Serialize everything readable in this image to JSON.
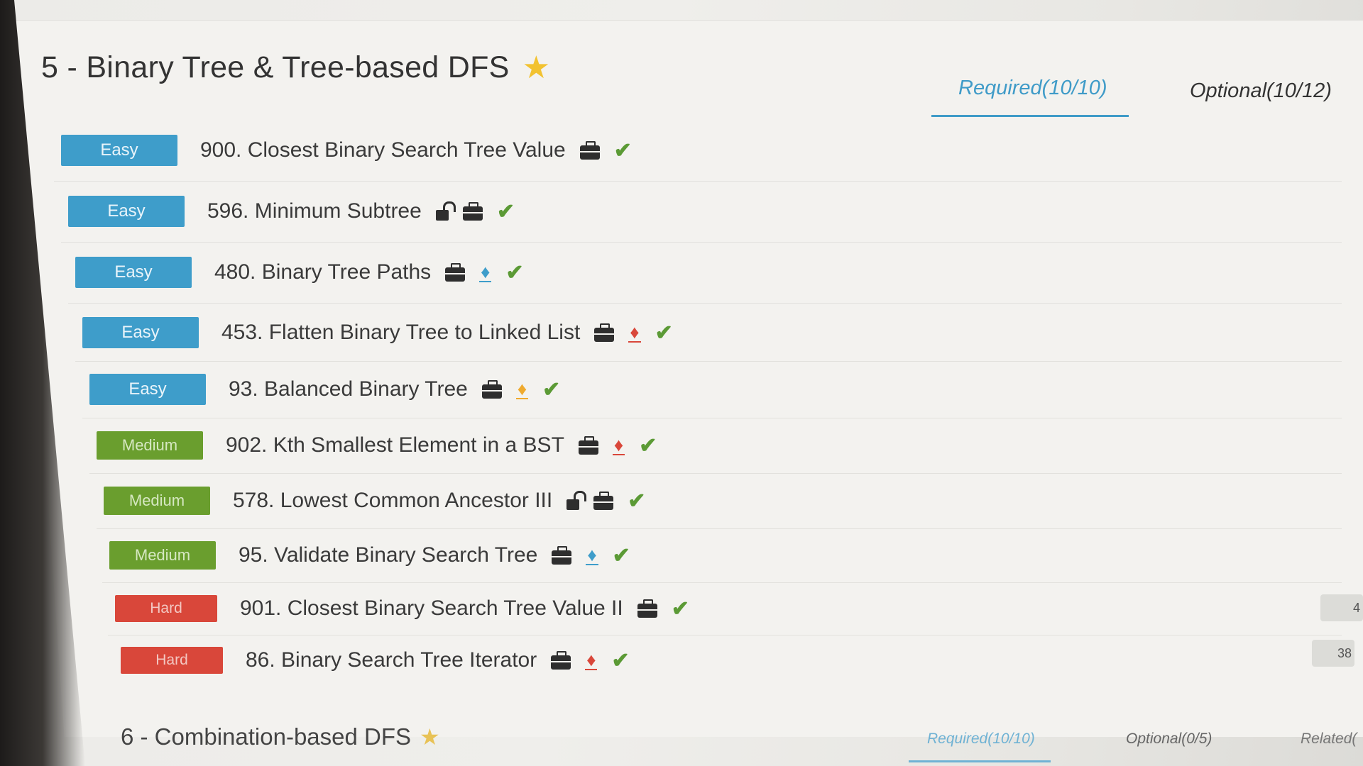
{
  "section": {
    "title": "5 - Binary Tree & Tree-based DFS",
    "star_icon": "star-icon",
    "tabs": {
      "required": "Required(10/10)",
      "optional": "Optional(10/12)"
    }
  },
  "problems": [
    {
      "difficulty": "Easy",
      "title": "900. Closest Binary Search Tree Value",
      "icons": [
        "briefcase-icon",
        "check-icon"
      ]
    },
    {
      "difficulty": "Easy",
      "title": "596. Minimum Subtree",
      "icons": [
        "unlock-icon",
        "briefcase-icon",
        "check-icon"
      ]
    },
    {
      "difficulty": "Easy",
      "title": "480. Binary Tree Paths",
      "icons": [
        "briefcase-icon",
        "flame-blue-icon",
        "check-icon"
      ]
    },
    {
      "difficulty": "Easy",
      "title": "453. Flatten Binary Tree to Linked List",
      "icons": [
        "briefcase-icon",
        "flame-red-icon",
        "check-icon"
      ]
    },
    {
      "difficulty": "Easy",
      "title": "93. Balanced Binary Tree",
      "icons": [
        "briefcase-icon",
        "flame-orange-icon",
        "check-icon"
      ]
    },
    {
      "difficulty": "Medium",
      "title": "902. Kth Smallest Element in a BST",
      "icons": [
        "briefcase-icon",
        "flame-red-icon",
        "check-icon"
      ]
    },
    {
      "difficulty": "Medium",
      "title": "578. Lowest Common Ancestor III",
      "icons": [
        "unlock-icon",
        "briefcase-icon",
        "check-icon"
      ]
    },
    {
      "difficulty": "Medium",
      "title": "95. Validate Binary Search Tree",
      "icons": [
        "briefcase-icon",
        "flame-blue-icon",
        "check-icon"
      ]
    },
    {
      "difficulty": "Hard",
      "title": "901. Closest Binary Search Tree Value II",
      "icons": [
        "briefcase-icon",
        "check-icon"
      ]
    },
    {
      "difficulty": "Hard",
      "title": "86. Binary Search Tree Iterator",
      "icons": [
        "briefcase-icon",
        "flame-red-icon",
        "check-icon"
      ]
    }
  ],
  "next_section": {
    "title": "6 - Combination-based DFS",
    "tabs": {
      "required": "Required(10/10)",
      "optional": "Optional(0/5)",
      "related": "Related("
    }
  },
  "side_values": [
    "4",
    "38"
  ],
  "colors": {
    "easy": "#3e9dca",
    "medium": "#6a9e2e",
    "hard": "#d9473a",
    "accent": "#3f9bc8",
    "check": "#5b9a35",
    "star": "#f2c230"
  }
}
